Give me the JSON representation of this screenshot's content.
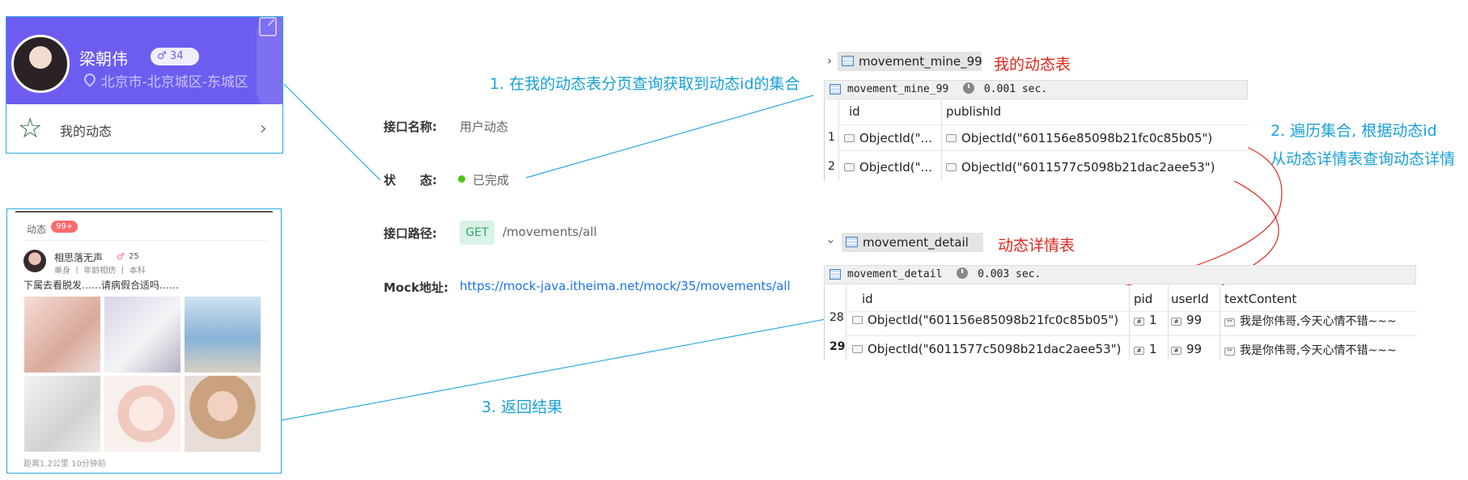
{
  "profile": {
    "name": "梁朝伟",
    "age": "34",
    "location": "北京市-北京城区-东城区",
    "menu_label": "我的动态"
  },
  "feed": {
    "tab_label": "动态",
    "count": "99+",
    "post": {
      "author": "相思落无声",
      "age": "25",
      "meta": "单身 丨 年龄相仿 丨 本科",
      "text": "下属去看脱发……请病假合适吗……",
      "footer": "距离1.2公里   10分钟前"
    }
  },
  "api": {
    "name_label": "接口名称:",
    "name_value": "用户动态",
    "status_label": "状　　态:",
    "status_value": "已完成",
    "path_label": "接口路径:",
    "method": "GET",
    "path": "/movements/all",
    "mock_label": "Mock地址:",
    "mock_url": "https://mock-java.itheima.net/mock/35/movements/all"
  },
  "annotations": {
    "step1": "1. 在我的动态表分页查询获取到动态id的集合",
    "step2_line1": "2. 遍历集合, 根据动态id",
    "step2_line2": "从动态详情表查询动态详情",
    "step3": "3. 返回结果",
    "mine_table_note": "我的动态表",
    "detail_table_note": "动态详情表"
  },
  "mine_panel": {
    "collection": "movement_mine_99",
    "result_name": "movement_mine_99",
    "elapsed": "0.001 sec.",
    "columns": [
      "id",
      "publishId"
    ],
    "rows": [
      {
        "num": "1",
        "id": "ObjectId(\"...",
        "publishId": "ObjectId(\"601156e85098b21fc0c85b05\")"
      },
      {
        "num": "2",
        "id": "ObjectId(\"...",
        "publishId": "ObjectId(\"6011577c5098b21dac2aee53\")"
      }
    ]
  },
  "detail_panel": {
    "collection": "movement_detail",
    "result_name": "movement_detail",
    "elapsed": "0.003 sec.",
    "columns": [
      "id",
      "pid",
      "userId",
      "textContent"
    ],
    "rows": [
      {
        "num": "28",
        "id": "ObjectId(\"601156e85098b21fc0c85b05\")",
        "pid": "1",
        "userId": "99",
        "textContent": "我是你伟哥,今天心情不错~~~"
      },
      {
        "num": "29",
        "id": "ObjectId(\"6011577c5098b21dac2aee53\")",
        "pid": "1",
        "userId": "99",
        "textContent": "我是你伟哥,今天心情不错~~~"
      }
    ]
  }
}
